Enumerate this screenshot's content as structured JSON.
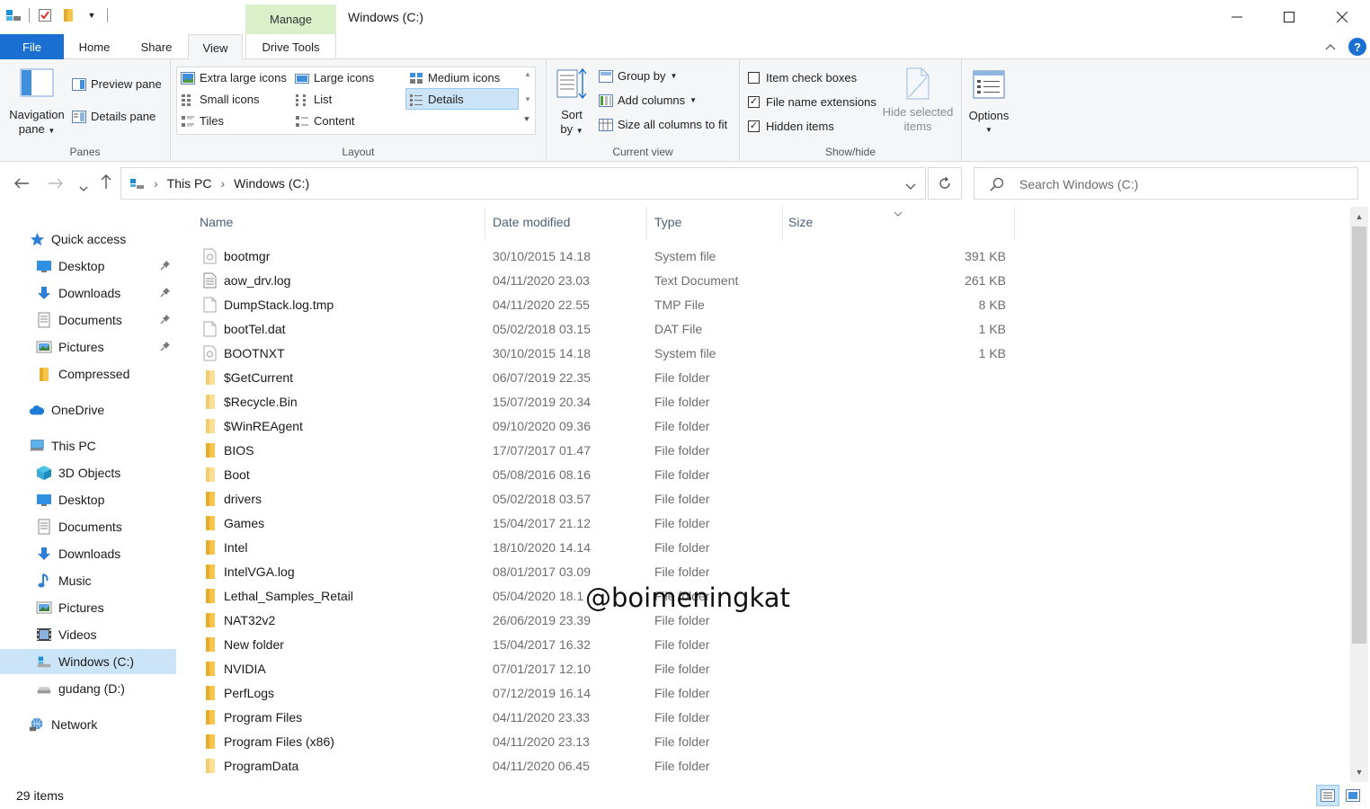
{
  "window": {
    "title": "Windows (C:)",
    "context_tab": "Manage"
  },
  "tabs": {
    "file": "File",
    "home": "Home",
    "share": "Share",
    "view": "View",
    "drive_tools": "Drive Tools"
  },
  "ribbon": {
    "panes": {
      "label": "Panes",
      "navigation_pane_1": "Navigation",
      "navigation_pane_2": "pane",
      "preview_pane": "Preview pane",
      "details_pane": "Details pane"
    },
    "layout": {
      "label": "Layout",
      "extra_large_icons": "Extra large icons",
      "large_icons": "Large icons",
      "medium_icons": "Medium icons",
      "small_icons": "Small icons",
      "list": "List",
      "details": "Details",
      "tiles": "Tiles",
      "content": "Content",
      "selected": "Details"
    },
    "current_view": {
      "label": "Current view",
      "sort_by_1": "Sort",
      "sort_by_2": "by",
      "group_by": "Group by",
      "add_columns": "Add columns",
      "size_all_columns": "Size all columns to fit"
    },
    "show_hide": {
      "label": "Show/hide",
      "item_check_boxes": "Item check boxes",
      "item_check_boxes_checked": false,
      "file_name_extensions": "File name extensions",
      "file_name_extensions_checked": true,
      "hidden_items": "Hidden items",
      "hidden_items_checked": true,
      "hide_selected_1": "Hide selected",
      "hide_selected_2": "items"
    },
    "options": "Options"
  },
  "address": {
    "crumbs": [
      "This PC",
      "Windows (C:)"
    ],
    "search_placeholder": "Search Windows (C:)"
  },
  "navpane": {
    "items": [
      {
        "label": "Quick access",
        "icon": "star-icon",
        "level": 0,
        "pinned": false
      },
      {
        "label": "Desktop",
        "icon": "desktop-icon",
        "level": 1,
        "pinned": true
      },
      {
        "label": "Downloads",
        "icon": "download-icon",
        "level": 1,
        "pinned": true
      },
      {
        "label": "Documents",
        "icon": "documents-icon",
        "level": 1,
        "pinned": true
      },
      {
        "label": "Pictures",
        "icon": "pictures-icon",
        "level": 1,
        "pinned": true
      },
      {
        "label": "Compressed",
        "icon": "folder-icon",
        "level": 1,
        "pinned": false
      },
      {
        "label": "OneDrive",
        "icon": "cloud-icon",
        "level": 0,
        "pinned": false
      },
      {
        "label": "This PC",
        "icon": "computer-icon",
        "level": 0,
        "pinned": false
      },
      {
        "label": "3D Objects",
        "icon": "cube-icon",
        "level": 1,
        "pinned": false
      },
      {
        "label": "Desktop",
        "icon": "desktop-icon",
        "level": 1,
        "pinned": false
      },
      {
        "label": "Documents",
        "icon": "documents-icon",
        "level": 1,
        "pinned": false
      },
      {
        "label": "Downloads",
        "icon": "download-icon",
        "level": 1,
        "pinned": false
      },
      {
        "label": "Music",
        "icon": "music-icon",
        "level": 1,
        "pinned": false
      },
      {
        "label": "Pictures",
        "icon": "pictures-icon",
        "level": 1,
        "pinned": false
      },
      {
        "label": "Videos",
        "icon": "video-icon",
        "level": 1,
        "pinned": false
      },
      {
        "label": "Windows (C:)",
        "icon": "windows-drive-icon",
        "level": 1,
        "pinned": false,
        "selected": true
      },
      {
        "label": "gudang (D:)",
        "icon": "drive-icon",
        "level": 1,
        "pinned": false
      },
      {
        "label": "Network",
        "icon": "network-icon",
        "level": 0,
        "pinned": false
      }
    ]
  },
  "columns": {
    "name": "Name",
    "date": "Date modified",
    "type": "Type",
    "size": "Size"
  },
  "files": [
    {
      "name": "bootmgr",
      "date": "30/10/2015 14.18",
      "type": "System file",
      "size": "391 KB",
      "kind": "sys"
    },
    {
      "name": "aow_drv.log",
      "date": "04/11/2020 23.03",
      "type": "Text Document",
      "size": "261 KB",
      "kind": "txt"
    },
    {
      "name": "DumpStack.log.tmp",
      "date": "04/11/2020 22.55",
      "type": "TMP File",
      "size": "8 KB",
      "kind": "file"
    },
    {
      "name": "bootTel.dat",
      "date": "05/02/2018 03.15",
      "type": "DAT File",
      "size": "1 KB",
      "kind": "file"
    },
    {
      "name": "BOOTNXT",
      "date": "30/10/2015 14.18",
      "type": "System file",
      "size": "1 KB",
      "kind": "sys"
    },
    {
      "name": "$GetCurrent",
      "date": "06/07/2019 22.35",
      "type": "File folder",
      "size": "",
      "kind": "folder-light"
    },
    {
      "name": "$Recycle.Bin",
      "date": "15/07/2019 20.34",
      "type": "File folder",
      "size": "",
      "kind": "folder-light"
    },
    {
      "name": "$WinREAgent",
      "date": "09/10/2020 09.36",
      "type": "File folder",
      "size": "",
      "kind": "folder-light"
    },
    {
      "name": "BIOS",
      "date": "17/07/2017 01.47",
      "type": "File folder",
      "size": "",
      "kind": "folder"
    },
    {
      "name": "Boot",
      "date": "05/08/2016 08.16",
      "type": "File folder",
      "size": "",
      "kind": "folder-light"
    },
    {
      "name": "drivers",
      "date": "05/02/2018 03.57",
      "type": "File folder",
      "size": "",
      "kind": "folder"
    },
    {
      "name": "Games",
      "date": "15/04/2017 21.12",
      "type": "File folder",
      "size": "",
      "kind": "folder"
    },
    {
      "name": "Intel",
      "date": "18/10/2020 14.14",
      "type": "File folder",
      "size": "",
      "kind": "folder"
    },
    {
      "name": "IntelVGA.log",
      "date": "08/01/2017 03.09",
      "type": "File folder",
      "size": "",
      "kind": "folder"
    },
    {
      "name": "Lethal_Samples_Retail",
      "date": "05/04/2020 18.1",
      "type": "File folder",
      "size": "",
      "kind": "folder"
    },
    {
      "name": "NAT32v2",
      "date": "26/06/2019 23.39",
      "type": "File folder",
      "size": "",
      "kind": "folder"
    },
    {
      "name": "New folder",
      "date": "15/04/2017 16.32",
      "type": "File folder",
      "size": "",
      "kind": "folder"
    },
    {
      "name": "NVIDIA",
      "date": "07/01/2017 12.10",
      "type": "File folder",
      "size": "",
      "kind": "folder"
    },
    {
      "name": "PerfLogs",
      "date": "07/12/2019 16.14",
      "type": "File folder",
      "size": "",
      "kind": "folder"
    },
    {
      "name": "Program Files",
      "date": "04/11/2020 23.33",
      "type": "File folder",
      "size": "",
      "kind": "folder"
    },
    {
      "name": "Program Files (x86)",
      "date": "04/11/2020 23.13",
      "type": "File folder",
      "size": "",
      "kind": "folder"
    },
    {
      "name": "ProgramData",
      "date": "04/11/2020 06.45",
      "type": "File folder",
      "size": "",
      "kind": "folder-light"
    }
  ],
  "status": {
    "item_count": "29 items"
  },
  "watermark": "@boimeningkat",
  "colors": {
    "accent": "#1a6fd1",
    "selection": "#cce4f7",
    "manage_tab": "#d9f0c8",
    "folder": "#f8c54a",
    "folder_light": "#fbdf93"
  }
}
